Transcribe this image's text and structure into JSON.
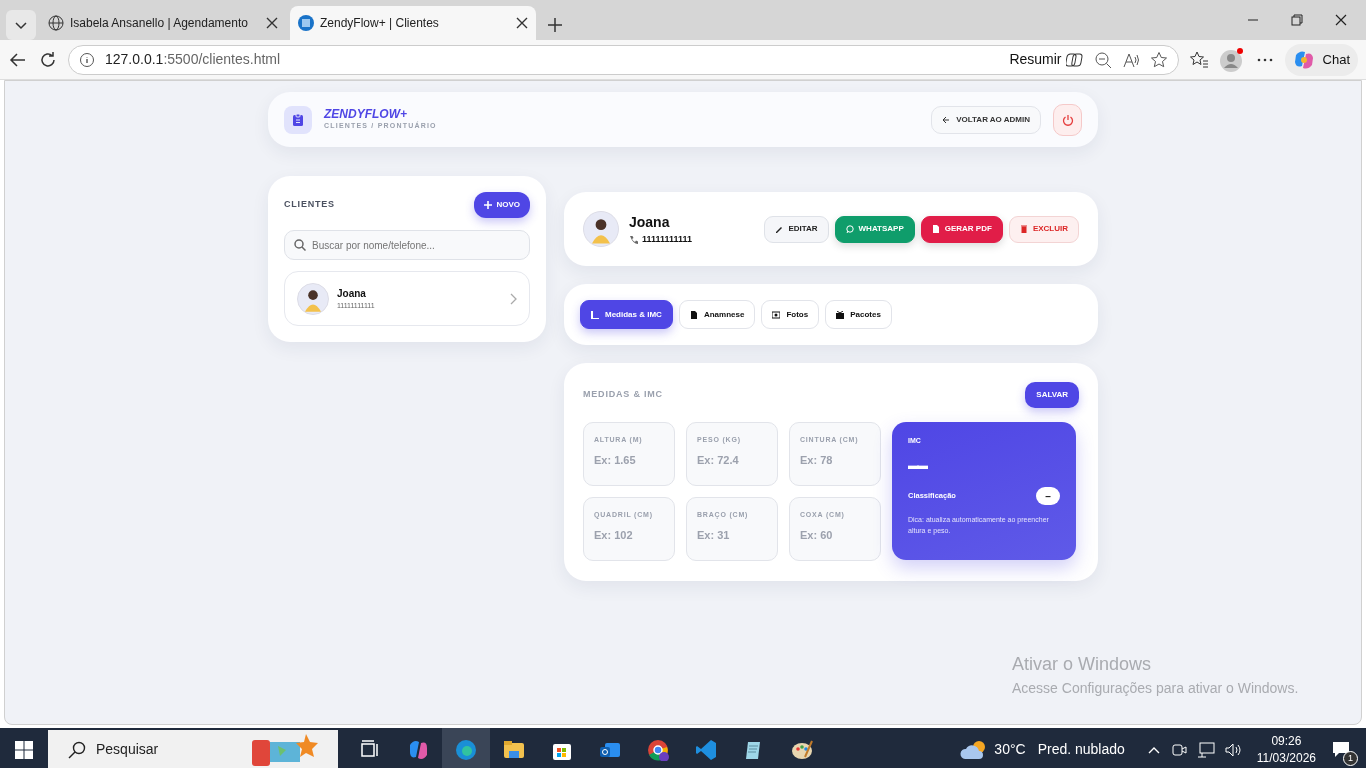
{
  "browser": {
    "tabs": [
      {
        "title": "Isabela Ansanello | Agendamento",
        "selected": false
      },
      {
        "title": "ZendyFlow+ | Clientes",
        "selected": true
      }
    ],
    "address": {
      "host": "127.0.0.1",
      "path": ":5500/clientes.html"
    },
    "summarize": "Resumir",
    "chat": "Chat"
  },
  "header": {
    "brand": "ZENDYFLOW+",
    "subtitle": "CLIENTES / PRONTUÁRIO",
    "back_button": "VOLTAR AO ADMIN"
  },
  "clients_panel": {
    "title": "CLIENTES",
    "new_button": "NOVO",
    "search": {
      "placeholder": "Buscar por nome/telefone..."
    },
    "clients": [
      {
        "name": "Joana",
        "phone": "11111111111"
      }
    ]
  },
  "profile": {
    "name": "Joana",
    "phone": "11111111111",
    "actions": [
      {
        "label": "EDITAR",
        "kind": "edit"
      },
      {
        "label": "WHATSAPP",
        "kind": "whatsapp"
      },
      {
        "label": "GERAR PDF",
        "kind": "pdf"
      },
      {
        "label": "EXCLUIR",
        "kind": "delete"
      }
    ]
  },
  "tabs": [
    {
      "label": "Medidas & IMC",
      "kind": "chart",
      "selected": true
    },
    {
      "label": "Anamnese",
      "kind": "doc",
      "selected": false
    },
    {
      "label": "Fotos",
      "kind": "photo",
      "selected": false
    },
    {
      "label": "Pacotes",
      "kind": "box",
      "selected": false
    }
  ],
  "measures": {
    "title": "MEDIDAS & IMC",
    "save_button": "SALVAR",
    "fields": [
      {
        "label": "ALTURA (M)",
        "placeholder": "Ex: 1.65"
      },
      {
        "label": "PESO (KG)",
        "placeholder": "Ex: 72.4"
      },
      {
        "label": "CINTURA (CM)",
        "placeholder": "Ex: 78"
      },
      {
        "label": "QUADRIL (CM)",
        "placeholder": "Ex: 102"
      },
      {
        "label": "BRAÇO (CM)",
        "placeholder": "Ex: 31"
      },
      {
        "label": "COXA (CM)",
        "placeholder": "Ex: 60"
      }
    ],
    "bmi": {
      "label": "IMC",
      "value": "▬▬",
      "classification_label": "Classificação",
      "classification": "–",
      "tip": "Dica: atualiza automaticamente ao preencher altura e peso."
    }
  },
  "activation": {
    "title": "Ativar o Windows",
    "text": "Acesse Configurações para ativar o Windows."
  },
  "taskbar": {
    "search": "Pesquisar",
    "temperature": "30°C",
    "weather": "Pred. nublado",
    "time": "09:26",
    "date": "11/03/2026",
    "notifications": "1"
  }
}
